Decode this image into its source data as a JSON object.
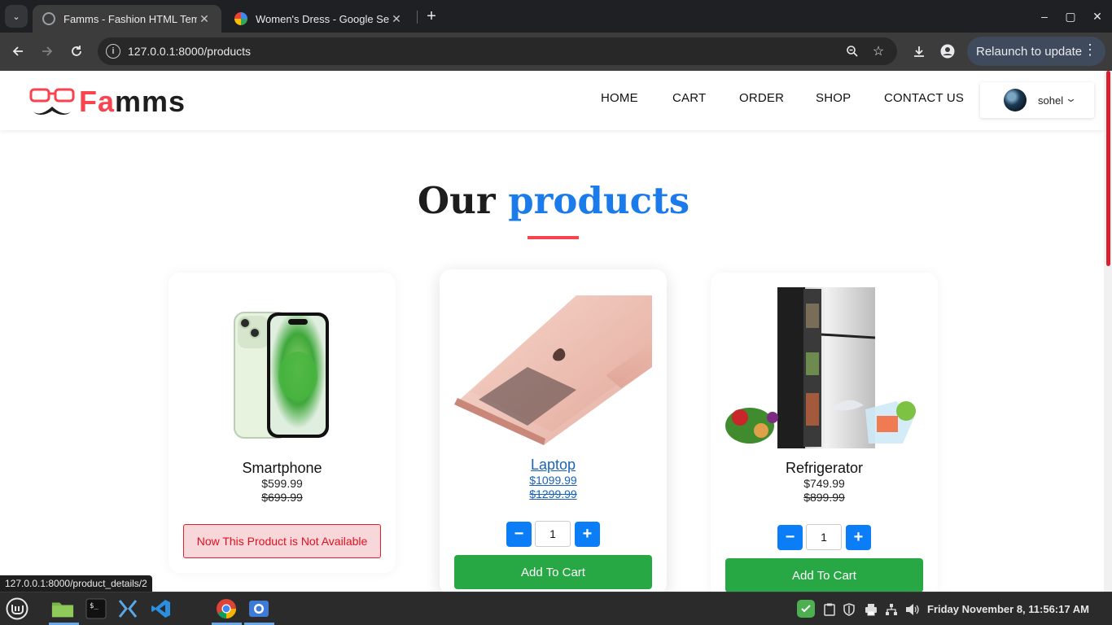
{
  "browser": {
    "tabs": [
      {
        "title": "Famms - Fashion HTML Temp",
        "close": "✕"
      },
      {
        "title": "Women's Dress - Google Sea",
        "close": "✕"
      }
    ],
    "tab_list_icon": "⌄",
    "new_tab": "+",
    "window_controls": {
      "minimize": "–",
      "restore": "▢",
      "close": "✕"
    },
    "url": "127.0.0.1:8000/products",
    "relaunch_label": "Relaunch to update",
    "status_url": "127.0.0.1:8000/product_details/2"
  },
  "site": {
    "logo": {
      "accent_letters": "Fa",
      "rest": "mms"
    },
    "nav": [
      "HOME",
      "CART",
      "ORDER",
      "SHOP",
      "CONTACT US"
    ],
    "user": {
      "name": "sohel"
    }
  },
  "section": {
    "heading_dark": "Our",
    "heading_blue": "products"
  },
  "products": [
    {
      "name": "Smartphone",
      "price": "$599.99",
      "old_price": "$699.99",
      "unavailable_message": "Now This Product is Not Available"
    },
    {
      "name": "Laptop",
      "price": "$1099.99",
      "old_price": "$1299.99",
      "quantity": "1",
      "minus": "−",
      "plus": "+",
      "cart_label": "Add To Cart"
    },
    {
      "name": "Refrigerator",
      "price": "$749.99",
      "old_price": "$899.99",
      "quantity": "1",
      "minus": "−",
      "plus": "+",
      "cart_label": "Add To Cart"
    }
  ],
  "taskbar": {
    "clock": "Friday November  8, 11:56:17 AM"
  },
  "colors": {
    "accent_red": "#f7444e",
    "heading_blue": "#1b7bea",
    "qty_blue": "#0b7df6",
    "cart_green": "#28a745"
  }
}
